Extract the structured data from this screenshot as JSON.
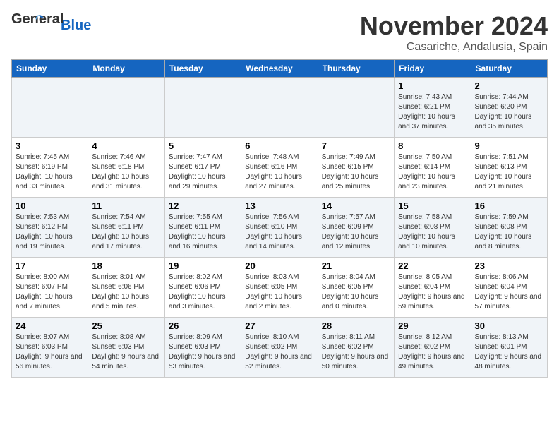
{
  "header": {
    "logo_general": "General",
    "logo_blue": "Blue",
    "month": "November 2024",
    "location": "Casariche, Andalusia, Spain"
  },
  "weekdays": [
    "Sunday",
    "Monday",
    "Tuesday",
    "Wednesday",
    "Thursday",
    "Friday",
    "Saturday"
  ],
  "weeks": [
    [
      {
        "day": "",
        "info": ""
      },
      {
        "day": "",
        "info": ""
      },
      {
        "day": "",
        "info": ""
      },
      {
        "day": "",
        "info": ""
      },
      {
        "day": "",
        "info": ""
      },
      {
        "day": "1",
        "info": "Sunrise: 7:43 AM\nSunset: 6:21 PM\nDaylight: 10 hours and 37 minutes."
      },
      {
        "day": "2",
        "info": "Sunrise: 7:44 AM\nSunset: 6:20 PM\nDaylight: 10 hours and 35 minutes."
      }
    ],
    [
      {
        "day": "3",
        "info": "Sunrise: 7:45 AM\nSunset: 6:19 PM\nDaylight: 10 hours and 33 minutes."
      },
      {
        "day": "4",
        "info": "Sunrise: 7:46 AM\nSunset: 6:18 PM\nDaylight: 10 hours and 31 minutes."
      },
      {
        "day": "5",
        "info": "Sunrise: 7:47 AM\nSunset: 6:17 PM\nDaylight: 10 hours and 29 minutes."
      },
      {
        "day": "6",
        "info": "Sunrise: 7:48 AM\nSunset: 6:16 PM\nDaylight: 10 hours and 27 minutes."
      },
      {
        "day": "7",
        "info": "Sunrise: 7:49 AM\nSunset: 6:15 PM\nDaylight: 10 hours and 25 minutes."
      },
      {
        "day": "8",
        "info": "Sunrise: 7:50 AM\nSunset: 6:14 PM\nDaylight: 10 hours and 23 minutes."
      },
      {
        "day": "9",
        "info": "Sunrise: 7:51 AM\nSunset: 6:13 PM\nDaylight: 10 hours and 21 minutes."
      }
    ],
    [
      {
        "day": "10",
        "info": "Sunrise: 7:53 AM\nSunset: 6:12 PM\nDaylight: 10 hours and 19 minutes."
      },
      {
        "day": "11",
        "info": "Sunrise: 7:54 AM\nSunset: 6:11 PM\nDaylight: 10 hours and 17 minutes."
      },
      {
        "day": "12",
        "info": "Sunrise: 7:55 AM\nSunset: 6:11 PM\nDaylight: 10 hours and 16 minutes."
      },
      {
        "day": "13",
        "info": "Sunrise: 7:56 AM\nSunset: 6:10 PM\nDaylight: 10 hours and 14 minutes."
      },
      {
        "day": "14",
        "info": "Sunrise: 7:57 AM\nSunset: 6:09 PM\nDaylight: 10 hours and 12 minutes."
      },
      {
        "day": "15",
        "info": "Sunrise: 7:58 AM\nSunset: 6:08 PM\nDaylight: 10 hours and 10 minutes."
      },
      {
        "day": "16",
        "info": "Sunrise: 7:59 AM\nSunset: 6:08 PM\nDaylight: 10 hours and 8 minutes."
      }
    ],
    [
      {
        "day": "17",
        "info": "Sunrise: 8:00 AM\nSunset: 6:07 PM\nDaylight: 10 hours and 7 minutes."
      },
      {
        "day": "18",
        "info": "Sunrise: 8:01 AM\nSunset: 6:06 PM\nDaylight: 10 hours and 5 minutes."
      },
      {
        "day": "19",
        "info": "Sunrise: 8:02 AM\nSunset: 6:06 PM\nDaylight: 10 hours and 3 minutes."
      },
      {
        "day": "20",
        "info": "Sunrise: 8:03 AM\nSunset: 6:05 PM\nDaylight: 10 hours and 2 minutes."
      },
      {
        "day": "21",
        "info": "Sunrise: 8:04 AM\nSunset: 6:05 PM\nDaylight: 10 hours and 0 minutes."
      },
      {
        "day": "22",
        "info": "Sunrise: 8:05 AM\nSunset: 6:04 PM\nDaylight: 9 hours and 59 minutes."
      },
      {
        "day": "23",
        "info": "Sunrise: 8:06 AM\nSunset: 6:04 PM\nDaylight: 9 hours and 57 minutes."
      }
    ],
    [
      {
        "day": "24",
        "info": "Sunrise: 8:07 AM\nSunset: 6:03 PM\nDaylight: 9 hours and 56 minutes."
      },
      {
        "day": "25",
        "info": "Sunrise: 8:08 AM\nSunset: 6:03 PM\nDaylight: 9 hours and 54 minutes."
      },
      {
        "day": "26",
        "info": "Sunrise: 8:09 AM\nSunset: 6:03 PM\nDaylight: 9 hours and 53 minutes."
      },
      {
        "day": "27",
        "info": "Sunrise: 8:10 AM\nSunset: 6:02 PM\nDaylight: 9 hours and 52 minutes."
      },
      {
        "day": "28",
        "info": "Sunrise: 8:11 AM\nSunset: 6:02 PM\nDaylight: 9 hours and 50 minutes."
      },
      {
        "day": "29",
        "info": "Sunrise: 8:12 AM\nSunset: 6:02 PM\nDaylight: 9 hours and 49 minutes."
      },
      {
        "day": "30",
        "info": "Sunrise: 8:13 AM\nSunset: 6:01 PM\nDaylight: 9 hours and 48 minutes."
      }
    ]
  ]
}
